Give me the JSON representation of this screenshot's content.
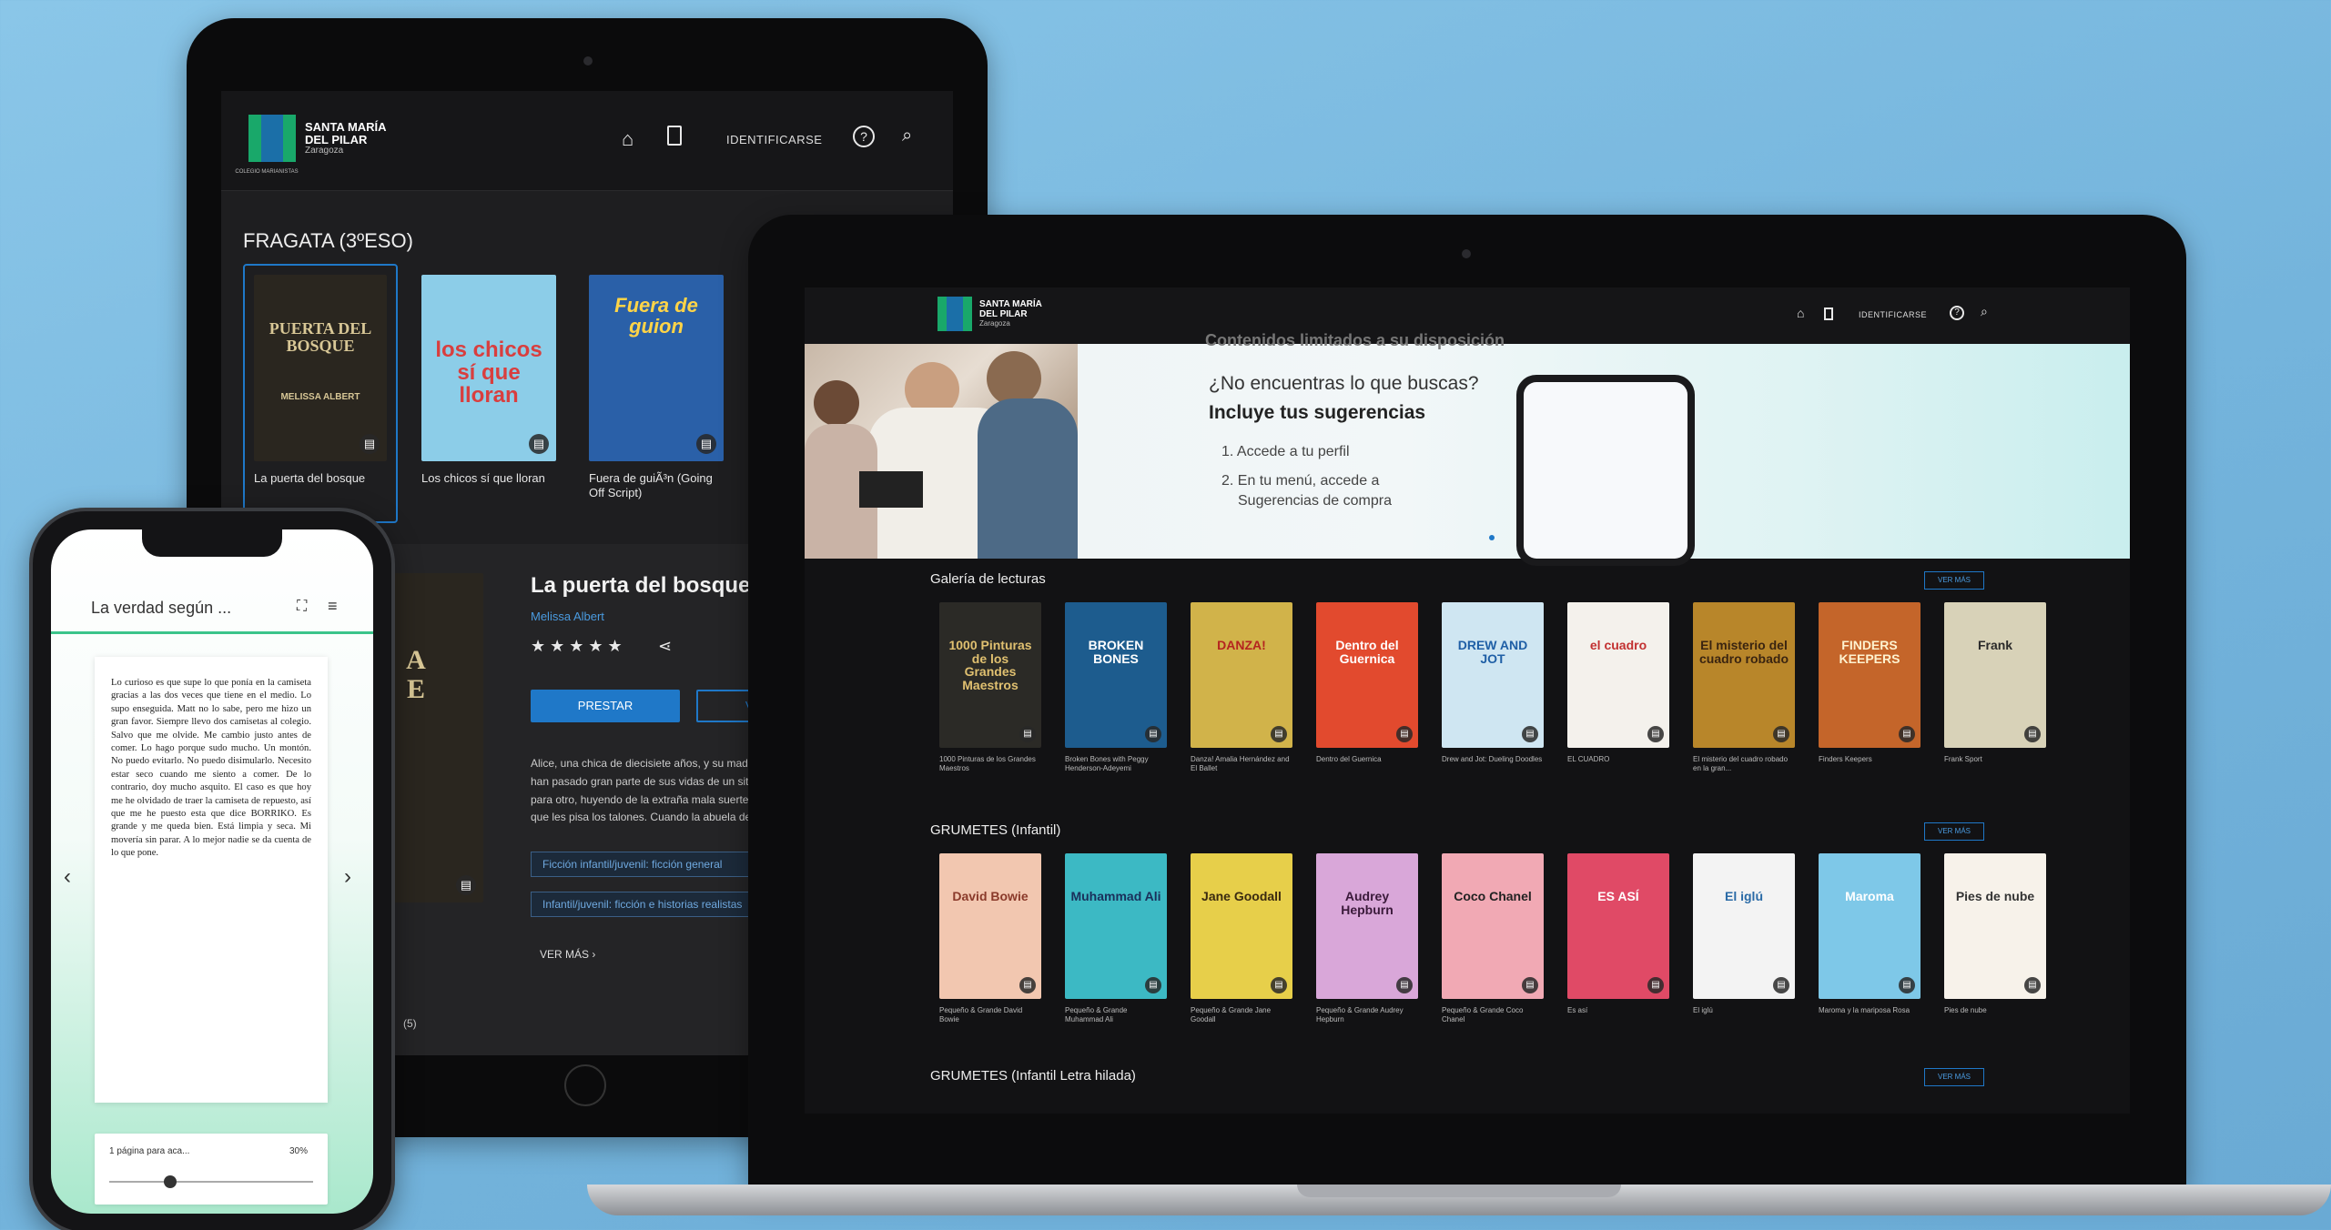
{
  "brand": {
    "line1": "SANTA MARÍA",
    "line2": "DEL PILAR",
    "line3": "Zaragoza",
    "badge": "COLEGIO MARIANISTAS"
  },
  "tablet": {
    "nav": {
      "login": "IDENTIFICARSE"
    },
    "section_title": "FRAGATA (3ºESO)",
    "books": [
      {
        "caption": "La puerta del bosque",
        "cover": "PUERTA DEL BOSQUE",
        "author": "MELISSA ALBERT",
        "bg": "#2a261f",
        "fg": "#d8c796"
      },
      {
        "caption": "Los chicos sí que lloran",
        "cover": "los chicos sí que lloran",
        "bg": "#8ccde8",
        "fg": "#d93e3e"
      },
      {
        "caption": "Fuera de guiÃ³n (Going Off Script)",
        "cover": "Fuera de guion",
        "bg": "#2a60a8",
        "fg": "#ffd447"
      }
    ],
    "detail": {
      "title": "La puerta del bosque",
      "author": "Melissa Albert",
      "rating": "★★★★★",
      "borrow": "PRESTAR",
      "view": "VI",
      "description": "Alice, una chica de diecisiete años, y su madre han pasado gran parte de sus vidas de un sitio para otro, huyendo de la extraña mala suerte que les pisa los talones. Cuando la abuela de Alice, la escurridiza autora...",
      "tags": [
        "Ficción infantil/juvenil: ficción general",
        "Infantil/juvenil: ficción e historias realistas"
      ],
      "more": "VER MÁS",
      "bottom_hint": "(5)"
    }
  },
  "laptop": {
    "nav": {
      "login": "IDENTIFICARSE"
    },
    "banner": {
      "cut_title": "Contenidos limitados a su disposición",
      "question": "¿No encuentras lo que buscas?",
      "headline": "Incluye tus sugerencias",
      "step1": "1. Accede a tu perfil",
      "step2a": "2. En tu menú, accede a",
      "step2b": "Sugerencias de compra"
    },
    "sections": [
      {
        "title": "Galería de lecturas",
        "more": "VER MÁS",
        "books": [
          {
            "cover": "1000 Pinturas de los Grandes Maestros",
            "caption": "1000 Pinturas de los Grandes Maestros",
            "bg": "#2b2a26",
            "fg": "#e0c070"
          },
          {
            "cover": "BROKEN BONES",
            "caption": "Broken Bones with Peggy Henderson-Adeyemi",
            "bg": "#1d5c8e",
            "fg": "#ffffff"
          },
          {
            "cover": "DANZA!",
            "caption": "Danza! Amalia Hernández and El Ballet",
            "bg": "#d1b34a",
            "fg": "#b5231f"
          },
          {
            "cover": "Dentro del Guernica",
            "caption": "Dentro del Guernica",
            "bg": "#e24a2e",
            "fg": "#ffffff"
          },
          {
            "cover": "DREW AND JOT",
            "caption": "Drew and Jot: Dueling Doodles",
            "bg": "#cfe6f2",
            "fg": "#1f5fa6"
          },
          {
            "cover": "el cuadro",
            "caption": "EL CUADRO",
            "bg": "#f4f1ec",
            "fg": "#c23030"
          },
          {
            "cover": "El misterio del cuadro robado",
            "caption": "El misterio del cuadro robado en la gran...",
            "bg": "#b8862a",
            "fg": "#3a2410"
          },
          {
            "cover": "FINDERS KEEPERS",
            "caption": "Finders Keepers",
            "bg": "#c4652a",
            "fg": "#fff3d0"
          },
          {
            "cover": "Frank",
            "caption": "Frank Sport",
            "bg": "#d8d2b8",
            "fg": "#2a2a2a"
          }
        ]
      },
      {
        "title": "GRUMETES (Infantil)",
        "more": "VER MÁS",
        "books": [
          {
            "cover": "David Bowie",
            "caption": "Pequeño & Grande David Bowie",
            "bg": "#f2c7b0",
            "fg": "#8a3a2a"
          },
          {
            "cover": "Muhammad Ali",
            "caption": "Pequeño & Grande Muhammad Ali",
            "bg": "#3cb9c4",
            "fg": "#1a2f5a"
          },
          {
            "cover": "Jane Goodall",
            "caption": "Pequeño & Grande Jane Goodall",
            "bg": "#e7cf4a",
            "fg": "#3a2a10"
          },
          {
            "cover": "Audrey Hepburn",
            "caption": "Pequeño & Grande Audrey Hepburn",
            "bg": "#d9a7d9",
            "fg": "#3a1a3a"
          },
          {
            "cover": "Coco Chanel",
            "caption": "Pequeño & Grande Coco Chanel",
            "bg": "#f1a9b4",
            "fg": "#222222"
          },
          {
            "cover": "ES ASÍ",
            "caption": "Es así",
            "bg": "#e04a66",
            "fg": "#ffffff"
          },
          {
            "cover": "El iglú",
            "caption": "El iglú",
            "bg": "#f3f3f3",
            "fg": "#2a6aa6"
          },
          {
            "cover": "Maroma",
            "caption": "Maroma y la mariposa Rosa",
            "bg": "#7ec8e8",
            "fg": "#ffffff"
          },
          {
            "cover": "Pies de nube",
            "caption": "Pies de nube",
            "bg": "#f7f2ea",
            "fg": "#333333"
          }
        ]
      },
      {
        "title": "GRUMETES (Infantil Letra hilada)",
        "more": "VER MÁS",
        "books": []
      }
    ]
  },
  "phone": {
    "title": "La verdad según ...",
    "text": "Lo curioso es que supe lo que ponía en la camiseta gracias a las dos veces que tiene en el medio. Lo supo enseguida. Matt no lo sabe, pero me hizo un gran favor. Siempre llevo dos camisetas al colegio. Salvo que me olvide. Me cambio justo antes de comer. Lo hago porque sudo mucho. Un montón. No puedo evitarlo. No puedo disimularlo. Necesito estar seco cuando me siento a comer. De lo contrario, doy mucho asquito. El caso es que hoy me he olvidado de traer la camiseta de repuesto, así que me he puesto esta que dice BORRIKO. Es grande y me queda bien. Está limpia y seca. Mi movería sin parar. A lo mejor nadie se da cuenta de lo que pone.",
    "progress_label": "1 página para aca...",
    "progress_percent": "30%",
    "progress_value": 0.3
  }
}
